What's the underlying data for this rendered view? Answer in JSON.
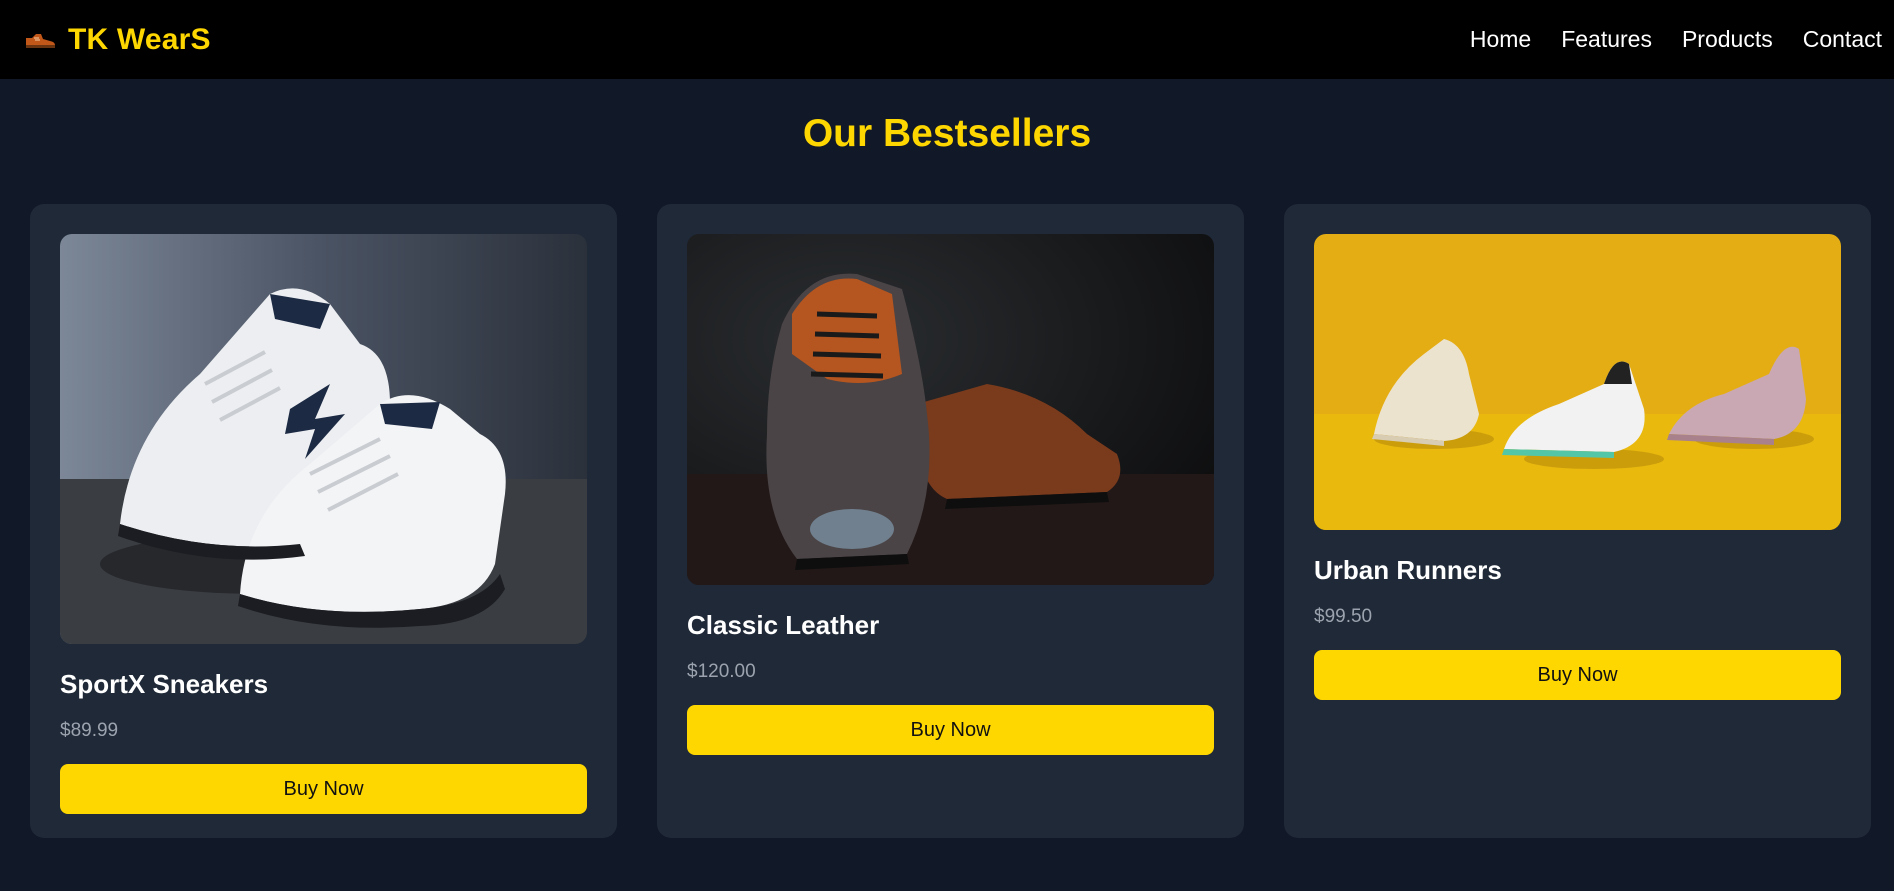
{
  "brand": {
    "name": "TK WearS",
    "icon": "shoe-icon",
    "color": "#FFD700"
  },
  "nav": {
    "items": [
      {
        "label": "Home"
      },
      {
        "label": "Features"
      },
      {
        "label": "Products"
      },
      {
        "label": "Contact"
      }
    ]
  },
  "section": {
    "title": "Our Bestsellers"
  },
  "products": [
    {
      "name": "SportX Sneakers",
      "price": "$89.99",
      "button": "Buy Now",
      "image": "white-sneakers-photo"
    },
    {
      "name": "Classic Leather",
      "price": "$120.00",
      "button": "Buy Now",
      "image": "leather-oxford-photo"
    },
    {
      "name": "Urban Runners",
      "price": "$99.50",
      "button": "Buy Now",
      "image": "three-runners-photo"
    }
  ],
  "colors": {
    "accent": "#FFD700",
    "background": "#111827",
    "card": "#1F2937",
    "navbar": "#000000",
    "price": "#9CA3AF"
  }
}
